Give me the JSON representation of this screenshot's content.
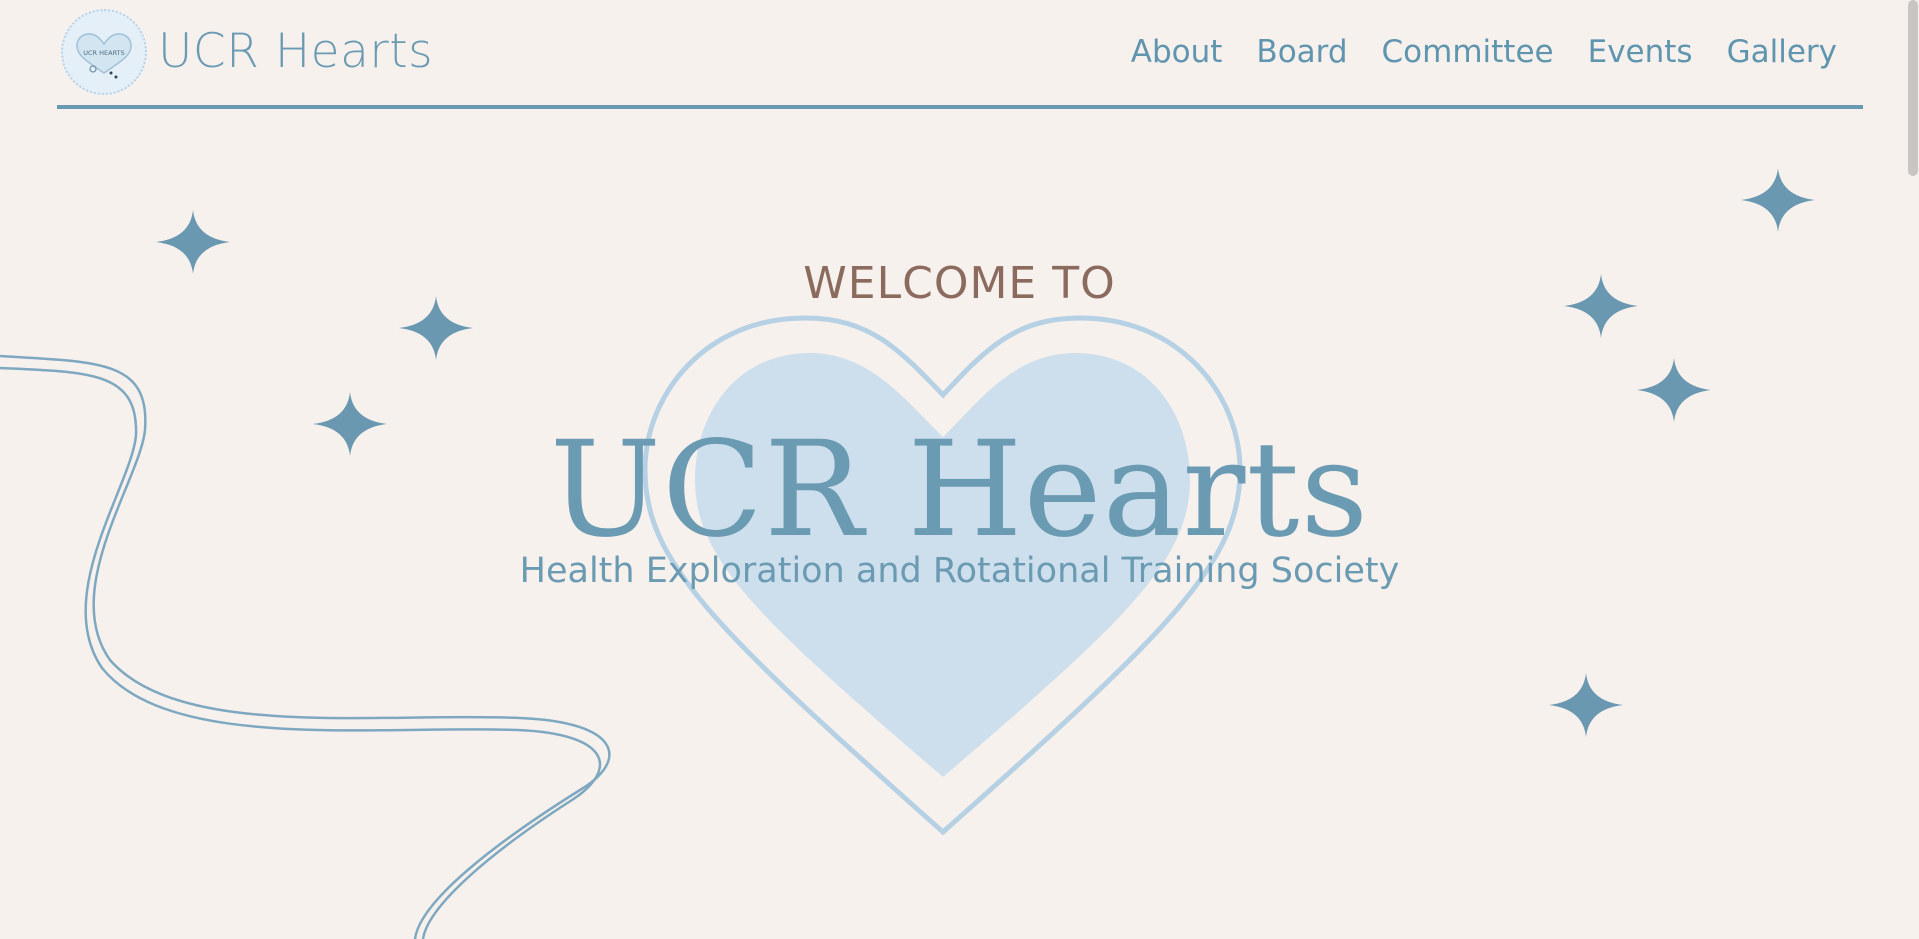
{
  "header": {
    "brand": "UCR Hearts",
    "nav": [
      "About",
      "Board",
      "Committee",
      "Events",
      "Gallery"
    ]
  },
  "hero": {
    "welcome": "WELCOME TO",
    "title": "UCR Hearts",
    "subtitle": "Health Exploration and Rotational Training Society"
  },
  "logo": {
    "text": "UCR HEARTS"
  },
  "colors": {
    "background": "#f7f1ee",
    "accent_blue": "#6b9bb2",
    "heart_fill": "#cddfed",
    "welcome_brown": "#8b6b5e"
  },
  "icons": [
    "logo-stethoscope-heart",
    "sparkle-icon",
    "stethoscope-line"
  ]
}
